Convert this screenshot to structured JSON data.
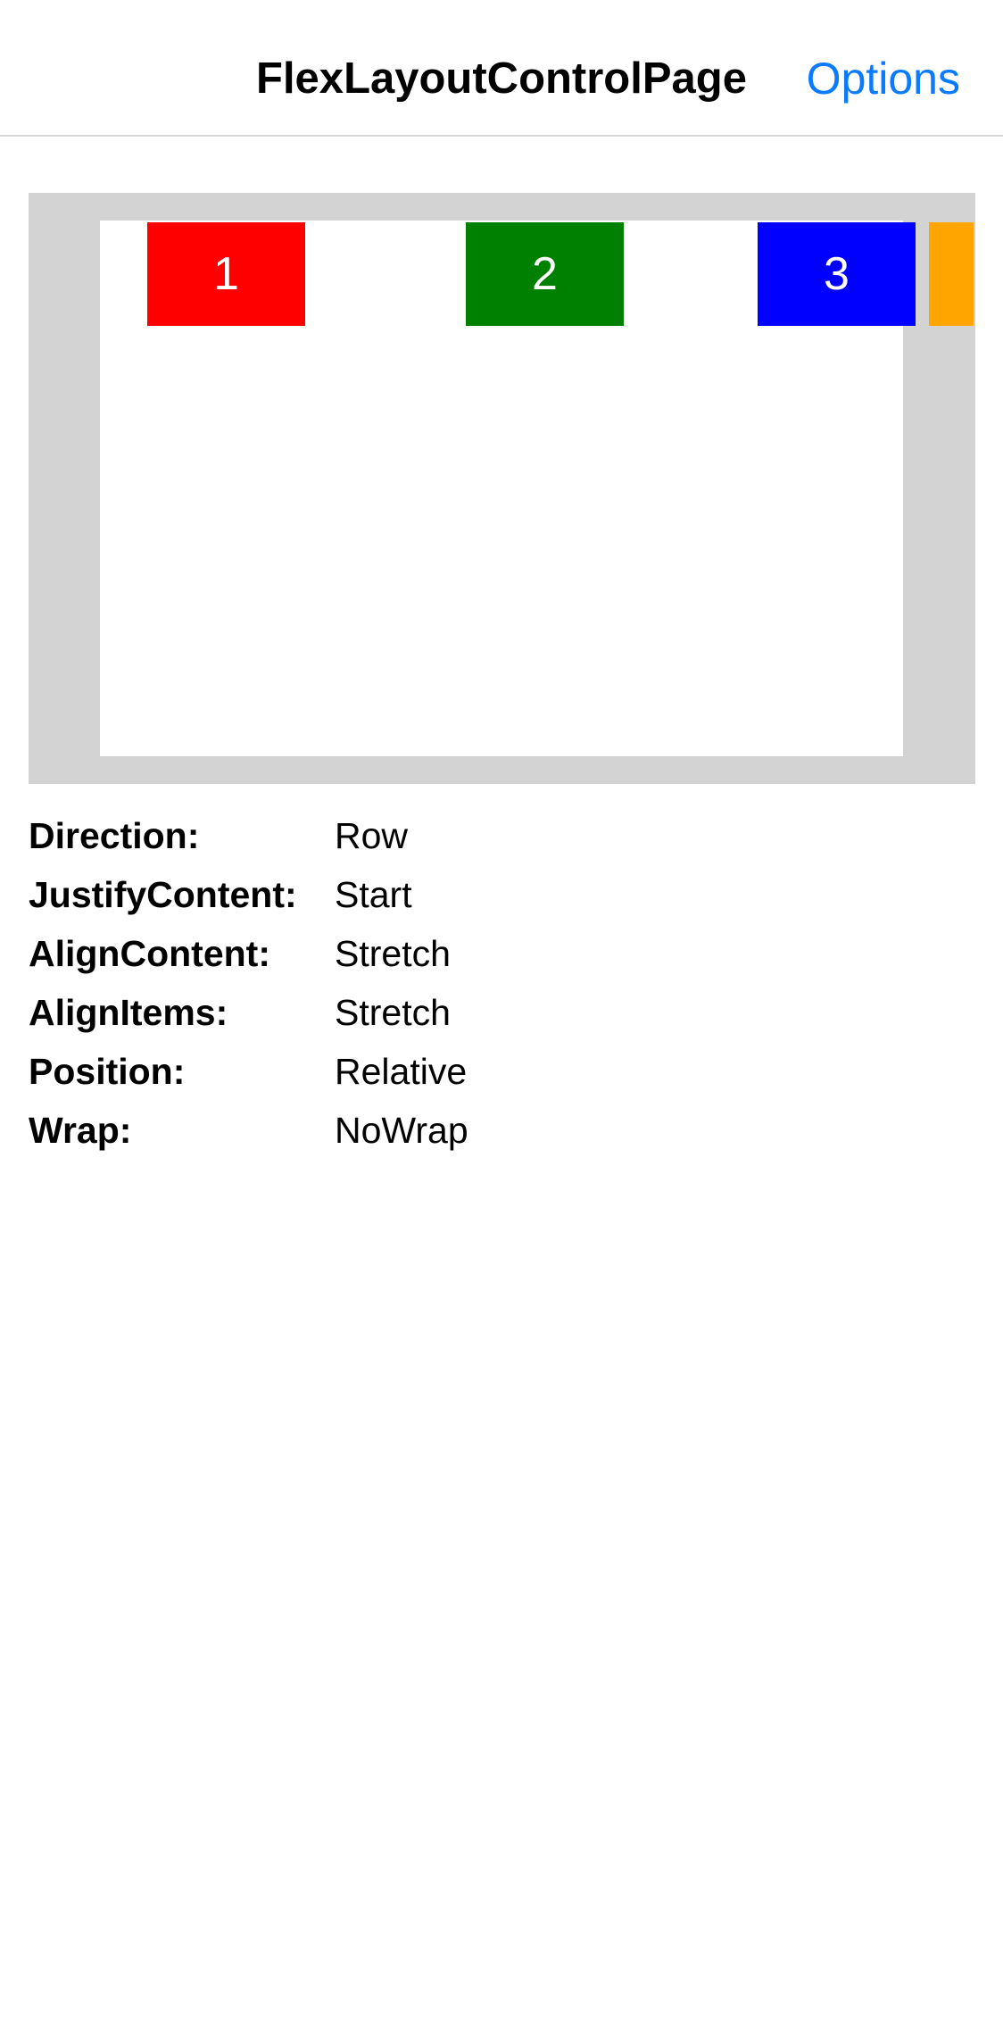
{
  "nav": {
    "title": "FlexLayoutControlPage",
    "options_label": "Options"
  },
  "colors": {
    "accent": "#0a7aff",
    "frame_background": "#d3d3d3",
    "container_background": "#ffffff",
    "divider": "#d8d8d8"
  },
  "flex_items": [
    {
      "label": "1",
      "color": "#ff0000"
    },
    {
      "label": "2",
      "color": "#008000"
    },
    {
      "label": "3",
      "color": "#0000ff"
    },
    {
      "label": "",
      "color": "#ffa500"
    }
  ],
  "properties": [
    {
      "label": "Direction:",
      "value": "Row"
    },
    {
      "label": "JustifyContent:",
      "value": "Start"
    },
    {
      "label": "AlignContent:",
      "value": "Stretch"
    },
    {
      "label": "AlignItems:",
      "value": "Stretch"
    },
    {
      "label": "Position:",
      "value": "Relative"
    },
    {
      "label": "Wrap:",
      "value": "NoWrap"
    }
  ]
}
